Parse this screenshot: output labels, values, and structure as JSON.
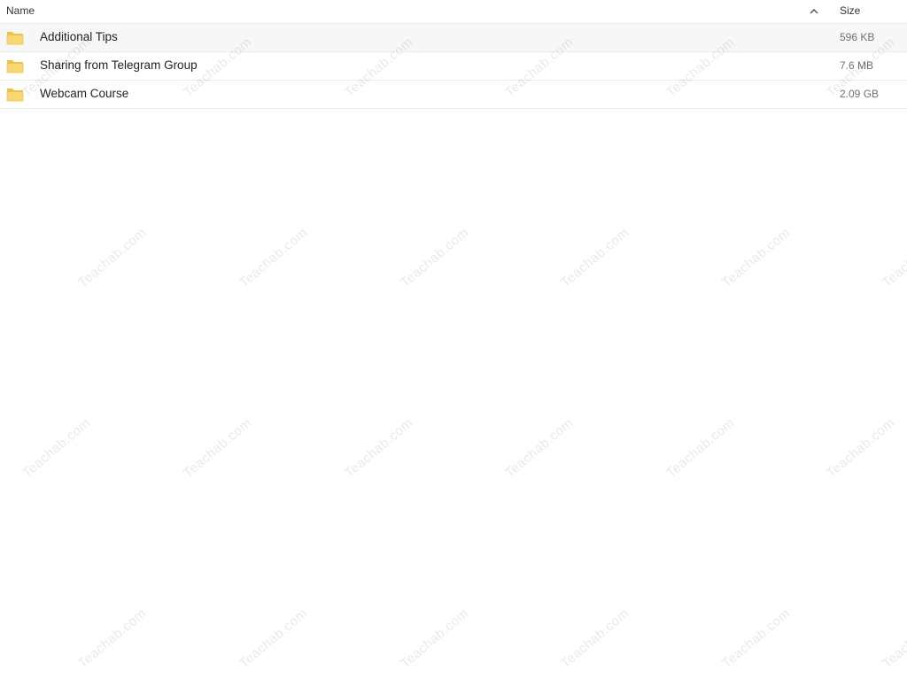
{
  "columns": {
    "name": "Name",
    "size": "Size"
  },
  "sort": {
    "column": "name",
    "direction": "ascending",
    "icon": "chevron-up-icon"
  },
  "files": [
    {
      "name": "Additional Tips",
      "size": "596 KB",
      "type": "folder",
      "icon": "folder-icon"
    },
    {
      "name": "Sharing from Telegram Group",
      "size": "7.6 MB",
      "type": "folder",
      "icon": "folder-icon"
    },
    {
      "name": "Webcam Course",
      "size": "2.09 GB",
      "type": "folder",
      "icon": "folder-icon"
    }
  ],
  "watermark": {
    "text": "Teachab.com"
  },
  "colors": {
    "folder_fill": "#f8d775",
    "folder_back": "#eec04f",
    "row_highlight": "#f7f7f7",
    "divider": "#ebebeb"
  }
}
